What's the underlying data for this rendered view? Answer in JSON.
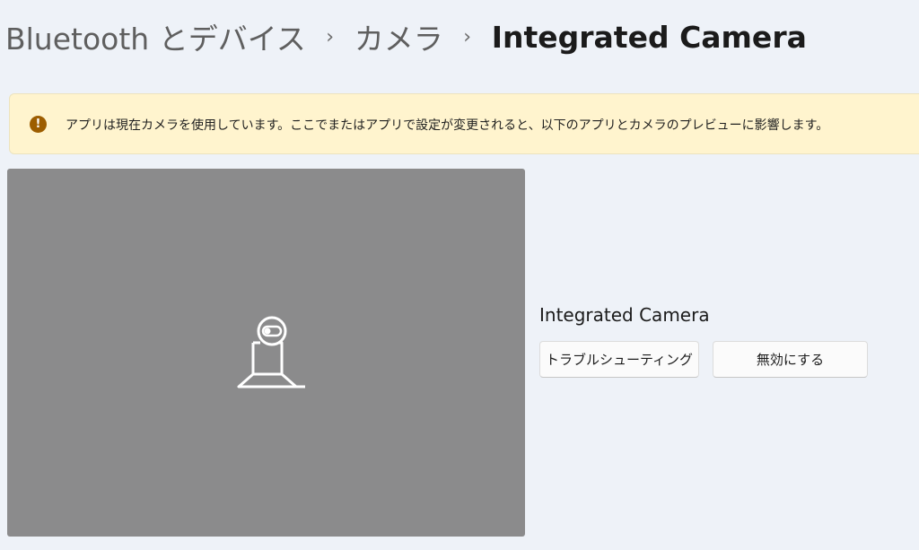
{
  "breadcrumb": {
    "items": [
      "Bluetooth とデバイス",
      "カメラ",
      "Integrated Camera"
    ],
    "separator": "›"
  },
  "banner": {
    "icon": "warning-icon",
    "icon_glyph": "!",
    "text": "アプリは現在カメラを使用しています。ここでまたはアプリで設定が変更されると、以下のアプリとカメラのプレビューに影響します。",
    "background": "#fff4ce",
    "icon_color": "#9d5d00"
  },
  "preview": {
    "icon": "camera-in-use-icon",
    "background": "#8b8b8c"
  },
  "device": {
    "name": "Integrated Camera",
    "troubleshoot_label": "トラブルシューティング",
    "disable_label": "無効にする"
  }
}
